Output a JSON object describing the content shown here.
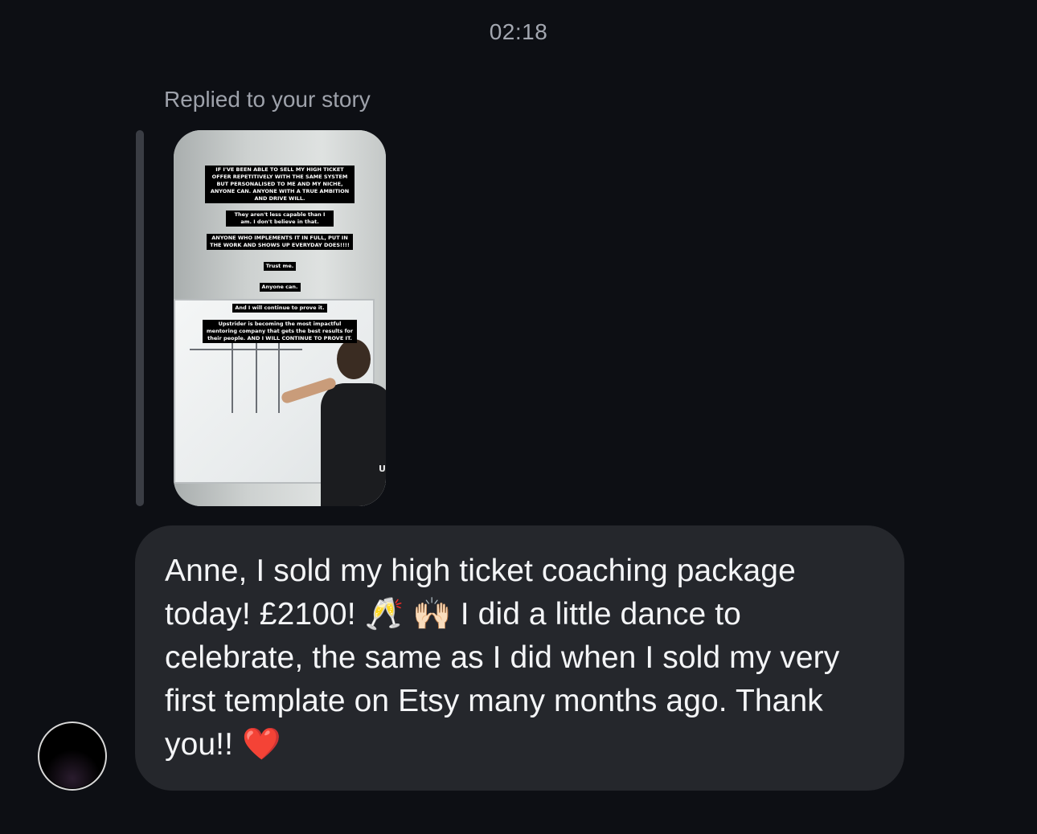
{
  "thread": {
    "timestamp": "02:18",
    "reply_label": "Replied to your story"
  },
  "story": {
    "captions": [
      "IF I'VE BEEN ABLE TO SELL MY HIGH TICKET OFFER REPETITIVELY WITH THE SAME SYSTEM BUT PERSONALISED TO ME AND MY NICHE, ANYONE CAN. ANYONE WITH A TRUE AMBITION AND DRIVE WILL.",
      "They aren't less capable than I am. I don't believe in that.",
      "ANYONE WHO IMPLEMENTS IT IN FULL, PUT IN THE WORK AND SHOWS UP EVERYDAY DOES!!!!",
      "Trust me.",
      "Anyone can.",
      "And I will continue to prove it.",
      "Upstrider is becoming the most impactful mentoring company that gets the best results for their people. AND I WILL CONTINUE TO PROVE IT."
    ],
    "shirt_text": "UPST"
  },
  "message": {
    "text": "Anne, I sold my high ticket coaching package today! £2100! 🥂 🙌🏻 I did a little dance to celebrate, the same as I did when I sold my very first template on Etsy many months ago. Thank you!! ❤️"
  },
  "sender": {
    "avatar_icon": "avatar-icon"
  },
  "colors": {
    "background": "#0d0f14",
    "bubble": "#25272c",
    "muted_text": "#9ea2ab",
    "reply_bar": "#3a3d44"
  }
}
